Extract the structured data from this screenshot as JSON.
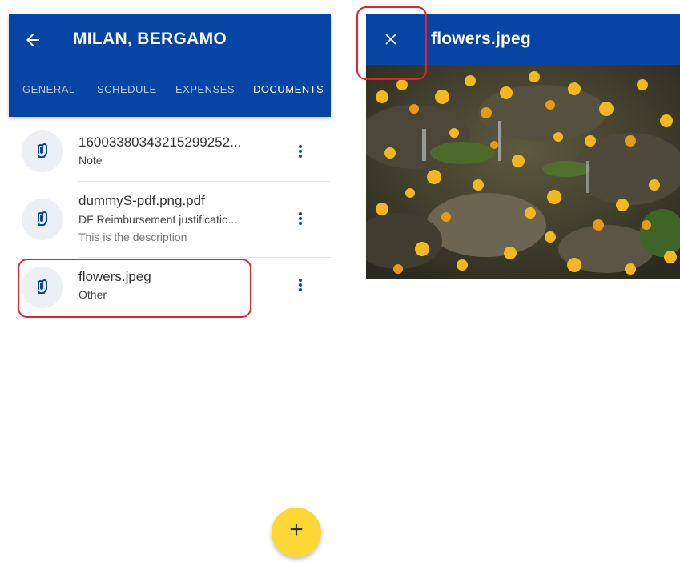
{
  "left_screen": {
    "header": {
      "title": "MILAN, BERGAMO",
      "back_icon": "arrow-left-icon"
    },
    "tabs": [
      {
        "label": "GENERAL",
        "active": false
      },
      {
        "label": "SCHEDULE",
        "active": false
      },
      {
        "label": "EXPENSES",
        "active": false
      },
      {
        "label": "DOCUMENTS",
        "active": true
      }
    ],
    "documents": [
      {
        "title": "16003380343215299252...",
        "type": "Note",
        "description": "",
        "icon": "paperclip-icon",
        "highlighted": false
      },
      {
        "title": "dummyS-pdf.png.pdf",
        "type": "DF Reimbursement justificatio...",
        "description": "This is the description",
        "icon": "paperclip-icon",
        "highlighted": false
      },
      {
        "title": "flowers.jpeg",
        "type": "Other",
        "description": "",
        "icon": "paperclip-icon",
        "highlighted": true
      }
    ],
    "fab": {
      "label": "+",
      "icon": "plus-icon"
    }
  },
  "right_screen": {
    "header": {
      "title": "flowers.jpeg",
      "close_icon": "close-icon"
    },
    "image": {
      "subject": "photo"
    }
  },
  "colors": {
    "primary": "#0645a3",
    "fab": "#fdd835",
    "highlight": "#e0252a",
    "icon_accent": "#0645a3"
  }
}
